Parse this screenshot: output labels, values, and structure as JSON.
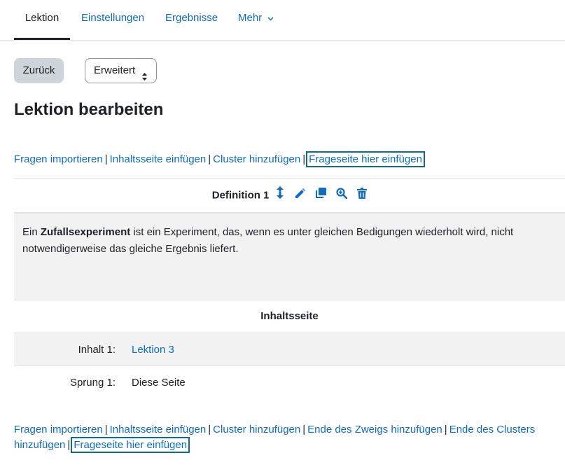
{
  "tabs": [
    {
      "label": "Lektion"
    },
    {
      "label": "Einstellungen"
    },
    {
      "label": "Ergebnisse"
    },
    {
      "label": "Mehr"
    }
  ],
  "actions": {
    "back_label": "Zurück",
    "select_value": "Erweitert"
  },
  "page_title": "Lektion bearbeiten",
  "links_top": {
    "import": "Fragen importieren",
    "content": "Inhaltsseite einfügen",
    "cluster": "Cluster hinzufügen",
    "question": "Frageseite hier einfügen",
    "sep": "|"
  },
  "lesson_page": {
    "title": "Definition 1",
    "text_before": "Ein ",
    "text_bold": "Zufallsexperiment",
    "text_after": " ist ein Experiment, das, wenn es unter gleichen Bedigungen wiederholt wird, nicht notwendigerweise das gleiche Ergebnis liefert.",
    "type_label": "Inhaltsseite",
    "answers": [
      {
        "label": "Inhalt 1:",
        "value": "Lektion 3"
      },
      {
        "label": "Sprung 1:",
        "value": "Diese Seite"
      }
    ]
  },
  "links_bottom": {
    "import": "Fragen importieren",
    "content": "Inhaltsseite einfügen",
    "cluster": "Cluster hinzufügen",
    "end_branch": "Ende des Zweigs hinzufügen",
    "end_cluster": "Ende des Clusters hinzufügen",
    "question": "Frageseite hier einfügen",
    "sep": "|"
  },
  "colors": {
    "link": "#0f6cbf",
    "accent_box": "#0f6c8c",
    "text": "#1d2125",
    "muted_bg": "#f2f2f2"
  }
}
